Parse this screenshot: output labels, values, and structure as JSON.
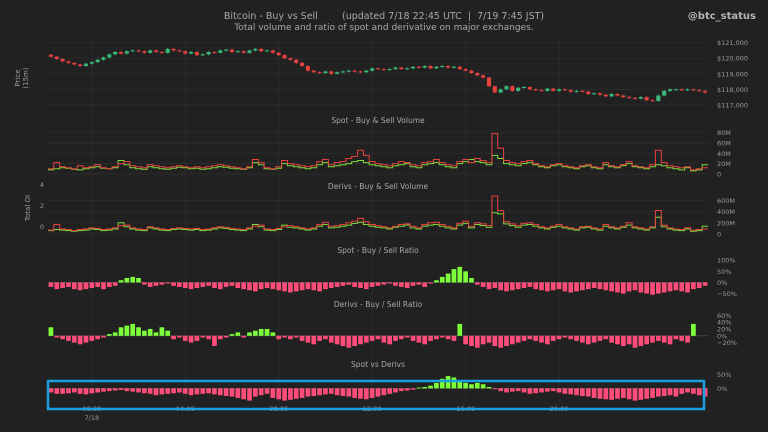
{
  "header": {
    "title": "Bitcoin - Buy vs Sell        (updated 7/18 22:45 UTC  |  7/19 7:45 JST)",
    "subtitle": "Total volume and ratio of spot and derivative on major exchanges.",
    "handle": "@btc_status"
  },
  "colors": {
    "up": "#3ab97a",
    "down": "#e8423f",
    "buy": "#7ddc3a",
    "sell": "#e8423f",
    "ratio_pos": "#7dff3a",
    "ratio_neg": "#ff4d7a",
    "highlight": "#1aa0e0",
    "grid": "#2e2e2e",
    "bg": "#212121"
  },
  "x_axis": {
    "ticks": [
      "00:00",
      "04:00",
      "08:00",
      "12:00",
      "16:00",
      "20:00"
    ],
    "date_label": "7/18"
  },
  "chart_data": [
    {
      "type": "candlestick",
      "ylabel": "Price\n(15m)",
      "yticks": [
        "$121,000",
        "$120,000",
        "$119,000",
        "$118,000",
        "$117,000"
      ],
      "ytick_values": [
        121000,
        120000,
        119000,
        118000,
        117000
      ],
      "ylim": [
        116800,
        121300
      ],
      "closes": [
        120100,
        119950,
        119800,
        119700,
        119600,
        119500,
        119650,
        119750,
        119900,
        120050,
        120250,
        120400,
        120300,
        120450,
        120500,
        120450,
        120350,
        120500,
        120400,
        120350,
        120600,
        120500,
        120450,
        120300,
        120400,
        120200,
        120250,
        120400,
        120350,
        120500,
        120550,
        120400,
        120450,
        120350,
        120500,
        120600,
        120450,
        120500,
        120350,
        120200,
        120000,
        119900,
        119700,
        119500,
        119200,
        119100,
        119050,
        119150,
        119000,
        119100,
        119150,
        119200,
        119150,
        119100,
        119200,
        119350,
        119300,
        119250,
        119300,
        119400,
        119300,
        119350,
        119450,
        119400,
        119500,
        119350,
        119450,
        119500,
        119400,
        119450,
        119300,
        119200,
        119050,
        118900,
        118750,
        118200,
        117800,
        118000,
        118200,
        117900,
        118100,
        118150,
        118000,
        117950,
        117900,
        118050,
        117900,
        118000,
        117950,
        117850,
        117900,
        117850,
        117700,
        117750,
        117650,
        117550,
        117700,
        117600,
        117500,
        117450,
        117400,
        117500,
        117300,
        117250,
        117600,
        117900,
        118000,
        118000,
        117950,
        118000,
        117950,
        117900,
        117800
      ]
    },
    {
      "type": "line",
      "title": "Spot - Buy & Sell Volume",
      "yticks": [
        "80M",
        "60M",
        "40M",
        "20M",
        "0"
      ],
      "ytick_values": [
        80,
        60,
        40,
        20,
        0
      ],
      "series": [
        {
          "name": "Buy",
          "values": [
            8,
            10,
            12,
            11,
            9,
            8,
            10,
            12,
            14,
            11,
            10,
            12,
            26,
            18,
            12,
            10,
            9,
            14,
            12,
            10,
            9,
            11,
            13,
            12,
            10,
            11,
            9,
            10,
            12,
            14,
            13,
            11,
            10,
            9,
            12,
            22,
            18,
            10,
            9,
            11,
            20,
            16,
            14,
            12,
            10,
            12,
            18,
            22,
            14,
            16,
            18,
            20,
            24,
            26,
            22,
            18,
            16,
            14,
            12,
            16,
            18,
            20,
            14,
            12,
            18,
            20,
            22,
            18,
            14,
            12,
            20,
            24,
            28,
            24,
            22,
            18,
            36,
            30,
            20,
            18,
            16,
            20,
            22,
            18,
            14,
            12,
            16,
            18,
            14,
            12,
            10,
            14,
            16,
            12,
            10,
            18,
            14,
            12,
            16,
            20,
            14,
            12,
            10,
            14,
            18,
            16,
            12,
            10,
            8,
            12,
            6,
            8,
            18
          ]
        },
        {
          "name": "Sell",
          "values": [
            10,
            22,
            14,
            12,
            10,
            16,
            12,
            14,
            18,
            12,
            10,
            14,
            20,
            24,
            16,
            14,
            12,
            18,
            16,
            14,
            12,
            14,
            16,
            14,
            12,
            14,
            12,
            14,
            16,
            18,
            16,
            14,
            12,
            10,
            14,
            28,
            22,
            12,
            10,
            14,
            26,
            20,
            18,
            16,
            14,
            16,
            24,
            28,
            18,
            22,
            24,
            30,
            34,
            46,
            36,
            24,
            20,
            18,
            16,
            20,
            24,
            22,
            18,
            16,
            22,
            24,
            28,
            22,
            18,
            16,
            24,
            28,
            22,
            30,
            26,
            22,
            78,
            50,
            26,
            22,
            20,
            24,
            26,
            20,
            16,
            14,
            18,
            20,
            16,
            14,
            12,
            16,
            18,
            14,
            12,
            22,
            16,
            14,
            18,
            24,
            16,
            14,
            12,
            18,
            46,
            22,
            16,
            14,
            12,
            14,
            8,
            10,
            12
          ]
        }
      ]
    },
    {
      "type": "line",
      "title": "Derivs - Buy & Sell Volume",
      "yticks": [
        "600M",
        "400M",
        "200M",
        "0"
      ],
      "ytick_values": [
        600,
        400,
        200,
        0
      ],
      "ylabel": "Total OI",
      "left_ticks": [
        "4",
        "2",
        "0"
      ],
      "series": [
        {
          "name": "Buy",
          "values": [
            60,
            80,
            70,
            60,
            50,
            60,
            70,
            90,
            80,
            60,
            70,
            90,
            200,
            130,
            90,
            70,
            60,
            110,
            90,
            70,
            60,
            80,
            90,
            80,
            70,
            80,
            60,
            70,
            90,
            110,
            100,
            80,
            70,
            60,
            90,
            170,
            130,
            70,
            60,
            80,
            160,
            120,
            110,
            90,
            70,
            90,
            140,
            170,
            110,
            120,
            140,
            160,
            190,
            210,
            170,
            140,
            120,
            110,
            90,
            120,
            140,
            160,
            110,
            90,
            140,
            160,
            170,
            140,
            110,
            90,
            160,
            190,
            110,
            170,
            150,
            120,
            380,
            360,
            180,
            150,
            120,
            160,
            170,
            140,
            110,
            90,
            120,
            140,
            110,
            90,
            70,
            110,
            120,
            90,
            70,
            140,
            110,
            90,
            120,
            160,
            110,
            90,
            70,
            110,
            300,
            130,
            90,
            70,
            60,
            90,
            50,
            60,
            140
          ]
        },
        {
          "name": "Sell",
          "values": [
            70,
            170,
            90,
            80,
            60,
            80,
            90,
            110,
            100,
            80,
            90,
            110,
            150,
            160,
            110,
            90,
            80,
            130,
            110,
            90,
            80,
            100,
            110,
            100,
            90,
            100,
            80,
            90,
            110,
            130,
            120,
            100,
            90,
            80,
            110,
            140,
            160,
            90,
            80,
            100,
            130,
            150,
            130,
            110,
            90,
            110,
            170,
            210,
            140,
            150,
            170,
            200,
            230,
            280,
            220,
            170,
            150,
            130,
            110,
            140,
            170,
            180,
            140,
            110,
            170,
            200,
            210,
            170,
            140,
            110,
            190,
            230,
            140,
            200,
            180,
            150,
            680,
            420,
            220,
            180,
            150,
            190,
            200,
            170,
            130,
            110,
            140,
            170,
            130,
            110,
            90,
            130,
            140,
            110,
            90,
            170,
            130,
            110,
            140,
            200,
            130,
            110,
            90,
            130,
            420,
            160,
            110,
            90,
            80,
            110,
            70,
            80,
            90
          ]
        }
      ]
    },
    {
      "type": "bar",
      "title": "Spot - Buy / Sell Ratio",
      "yticks": [
        "100%",
        "50%",
        "0%",
        "−50%"
      ],
      "ytick_values": [
        100,
        50,
        0,
        -50
      ],
      "ylim": [
        -70,
        110
      ],
      "values": [
        -20,
        -30,
        -25,
        -20,
        -30,
        -35,
        -30,
        -25,
        -20,
        -30,
        -20,
        -15,
        10,
        20,
        25,
        20,
        -10,
        -20,
        -15,
        -10,
        -5,
        -15,
        -20,
        -25,
        -30,
        -25,
        -20,
        -15,
        -25,
        -30,
        -20,
        -15,
        -25,
        -30,
        -35,
        -40,
        -30,
        -25,
        -30,
        -35,
        -40,
        -45,
        -40,
        -35,
        -30,
        -35,
        -40,
        -30,
        -25,
        -20,
        -15,
        -10,
        -20,
        -25,
        -30,
        -20,
        -15,
        -10,
        -5,
        -15,
        -20,
        -25,
        -15,
        -10,
        -20,
        -5,
        10,
        25,
        40,
        60,
        70,
        50,
        20,
        -10,
        -20,
        -30,
        -25,
        -35,
        -40,
        -35,
        -30,
        -25,
        -20,
        -30,
        -35,
        -40,
        -35,
        -30,
        -40,
        -45,
        -40,
        -35,
        -30,
        -25,
        -30,
        -35,
        -40,
        -45,
        -50,
        -40,
        -35,
        -45,
        -50,
        -55,
        -50,
        -45,
        -40,
        -35,
        -40,
        -45,
        -30,
        -25,
        -15
      ]
    },
    {
      "type": "bar",
      "title": "Derivs - Buy / Sell Ratio",
      "yticks": [
        "60%",
        "40%",
        "20%",
        "0%",
        "−20%"
      ],
      "ytick_values": [
        60,
        40,
        20,
        0,
        -20
      ],
      "ylim": [
        -30,
        70
      ],
      "values": [
        25,
        -5,
        -10,
        -15,
        -20,
        -25,
        -20,
        -15,
        -10,
        -5,
        5,
        10,
        25,
        30,
        35,
        25,
        15,
        20,
        10,
        25,
        15,
        -10,
        -5,
        -15,
        -20,
        -15,
        -5,
        -10,
        -30,
        -10,
        -5,
        5,
        10,
        -5,
        10,
        15,
        20,
        20,
        10,
        -10,
        -5,
        -10,
        -5,
        -15,
        -20,
        -25,
        -15,
        -10,
        -20,
        -25,
        -30,
        -35,
        -30,
        -25,
        -20,
        -15,
        -10,
        -20,
        -25,
        -15,
        -10,
        -5,
        -15,
        -20,
        -25,
        -15,
        -10,
        -5,
        -10,
        -15,
        35,
        -25,
        -30,
        -35,
        -25,
        -20,
        -30,
        -35,
        -30,
        -25,
        -20,
        -15,
        -10,
        -15,
        -20,
        -25,
        -15,
        -10,
        -5,
        -10,
        -15,
        -20,
        -25,
        -20,
        -15,
        -10,
        -20,
        -25,
        -30,
        -25,
        -35,
        -30,
        -25,
        -20,
        -15,
        -20,
        -25,
        -10,
        -15,
        -20,
        35
      ]
    },
    {
      "type": "bar",
      "title": "Spot vs Derivs",
      "yticks": [
        "50%",
        "0%"
      ],
      "ytick_values": [
        50,
        0
      ],
      "ylim": [
        -50,
        60
      ],
      "values": [
        -15,
        -20,
        -20,
        -18,
        -15,
        -20,
        -22,
        -18,
        -15,
        -12,
        -10,
        -8,
        -6,
        -10,
        -12,
        -15,
        -18,
        -20,
        -25,
        -22,
        -20,
        -18,
        -15,
        -20,
        -25,
        -22,
        -20,
        -18,
        -22,
        -25,
        -28,
        -30,
        -35,
        -40,
        -45,
        -30,
        -25,
        -20,
        -35,
        -40,
        -45,
        -42,
        -38,
        -35,
        -30,
        -28,
        -25,
        -22,
        -20,
        -25,
        -28,
        -30,
        -35,
        -38,
        -40,
        -35,
        -30,
        -25,
        -20,
        -15,
        -10,
        -8,
        -5,
        3,
        5,
        10,
        20,
        35,
        45,
        40,
        25,
        20,
        15,
        20,
        15,
        5,
        -3,
        -10,
        -15,
        -12,
        -10,
        -15,
        -20,
        -18,
        -15,
        -12,
        -10,
        -15,
        -20,
        -22,
        -25,
        -28,
        -30,
        -35,
        -38,
        -40,
        -42,
        -38,
        -35,
        -40,
        -45,
        -42,
        -38,
        -35,
        -30,
        -28,
        -25,
        -30,
        -20,
        -15,
        -20,
        -25,
        -30
      ]
    }
  ]
}
